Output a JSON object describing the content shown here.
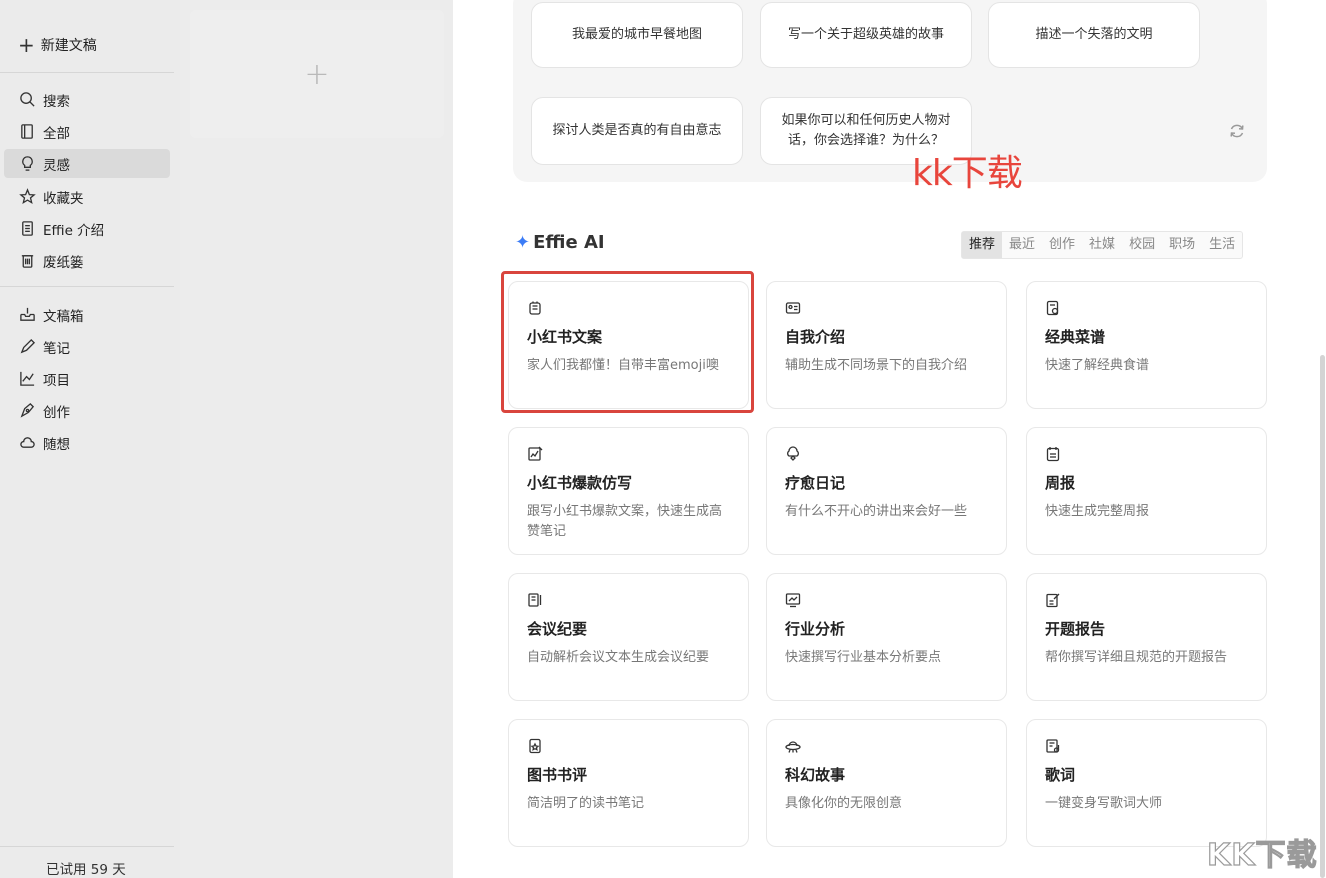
{
  "sidebar": {
    "new_doc": "新建文稿",
    "items_top": [
      {
        "label": "搜索",
        "icon": "search-icon"
      },
      {
        "label": "全部",
        "icon": "book-icon"
      },
      {
        "label": "灵感",
        "icon": "lightbulb-icon",
        "active": true
      },
      {
        "label": "收藏夹",
        "icon": "star-icon"
      },
      {
        "label": "Effie 介绍",
        "icon": "document-icon"
      },
      {
        "label": "废纸篓",
        "icon": "trash-icon"
      }
    ],
    "items_bottom": [
      {
        "label": "文稿箱",
        "icon": "inbox-icon"
      },
      {
        "label": "笔记",
        "icon": "pen-icon"
      },
      {
        "label": "项目",
        "icon": "chart-icon"
      },
      {
        "label": "创作",
        "icon": "nib-icon"
      },
      {
        "label": "随想",
        "icon": "cloud-icon"
      }
    ],
    "trial": "已试用 59 天"
  },
  "prompts": [
    "我最爱的城市早餐地图",
    "写一个关于超级英雄的故事",
    "描述一个失落的文明",
    "探讨人类是否真的有自由意志",
    "如果你可以和任何历史人物对话，你会选择谁？为什么？"
  ],
  "watermark": "kk下载",
  "corner_watermark": "KK下载",
  "ai": {
    "title": "Effie AI",
    "tabs": [
      "推荐",
      "最近",
      "创作",
      "社媒",
      "校园",
      "职场",
      "生活"
    ],
    "active_tab": "推荐",
    "cards": [
      {
        "title": "小红书文案",
        "desc": "家人们我都懂！自带丰富emoji噢",
        "icon": "note-icon"
      },
      {
        "title": "自我介绍",
        "desc": "辅助生成不同场景下的自我介绍",
        "icon": "id-card-icon"
      },
      {
        "title": "经典菜谱",
        "desc": "快速了解经典食谱",
        "icon": "recipe-icon"
      },
      {
        "title": "小红书爆款仿写",
        "desc": "跟写小红书爆款文案，快速生成高赞笔记",
        "icon": "edit-chart-icon"
      },
      {
        "title": "疗愈日记",
        "desc": "有什么不开心的讲出来会好一些",
        "icon": "healing-icon"
      },
      {
        "title": "周报",
        "desc": "快速生成完整周报",
        "icon": "calendar-icon"
      },
      {
        "title": "会议纪要",
        "desc": "自动解析会议文本生成会议纪要",
        "icon": "minutes-icon"
      },
      {
        "title": "行业分析",
        "desc": "快速撰写行业基本分析要点",
        "icon": "trend-icon"
      },
      {
        "title": "开题报告",
        "desc": "帮你撰写详细且规范的开题报告",
        "icon": "report-icon"
      },
      {
        "title": "图书书评",
        "desc": "简洁明了的读书笔记",
        "icon": "book-review-icon"
      },
      {
        "title": "科幻故事",
        "desc": "具像化你的无限创意",
        "icon": "ufo-icon"
      },
      {
        "title": "歌词",
        "desc": "一键变身写歌词大师",
        "icon": "lyrics-icon"
      }
    ]
  }
}
